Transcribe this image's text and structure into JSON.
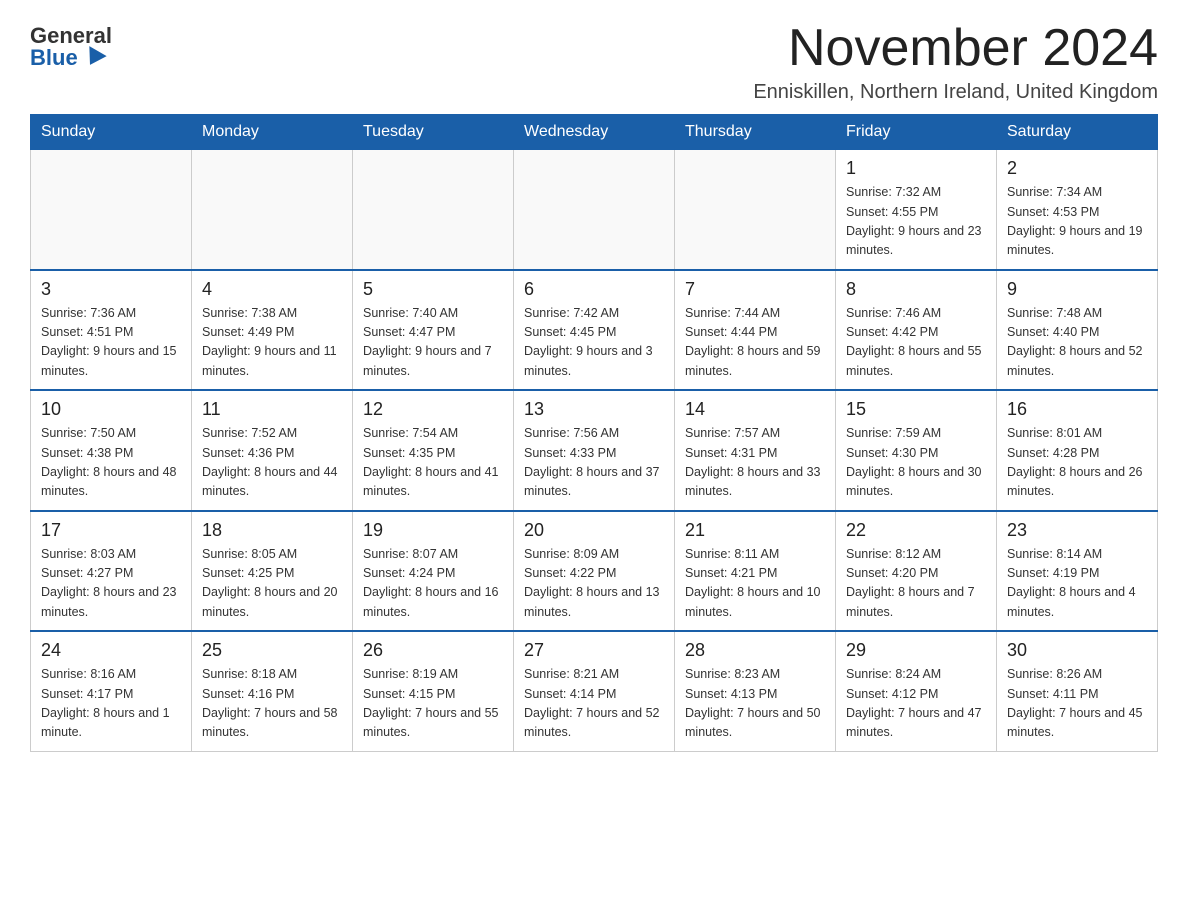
{
  "header": {
    "logo_general": "General",
    "logo_blue": "Blue",
    "month_title": "November 2024",
    "location": "Enniskillen, Northern Ireland, United Kingdom"
  },
  "calendar": {
    "weekdays": [
      "Sunday",
      "Monday",
      "Tuesday",
      "Wednesday",
      "Thursday",
      "Friday",
      "Saturday"
    ],
    "weeks": [
      [
        {
          "day": "",
          "sunrise": "",
          "sunset": "",
          "daylight": ""
        },
        {
          "day": "",
          "sunrise": "",
          "sunset": "",
          "daylight": ""
        },
        {
          "day": "",
          "sunrise": "",
          "sunset": "",
          "daylight": ""
        },
        {
          "day": "",
          "sunrise": "",
          "sunset": "",
          "daylight": ""
        },
        {
          "day": "",
          "sunrise": "",
          "sunset": "",
          "daylight": ""
        },
        {
          "day": "1",
          "sunrise": "Sunrise: 7:32 AM",
          "sunset": "Sunset: 4:55 PM",
          "daylight": "Daylight: 9 hours and 23 minutes."
        },
        {
          "day": "2",
          "sunrise": "Sunrise: 7:34 AM",
          "sunset": "Sunset: 4:53 PM",
          "daylight": "Daylight: 9 hours and 19 minutes."
        }
      ],
      [
        {
          "day": "3",
          "sunrise": "Sunrise: 7:36 AM",
          "sunset": "Sunset: 4:51 PM",
          "daylight": "Daylight: 9 hours and 15 minutes."
        },
        {
          "day": "4",
          "sunrise": "Sunrise: 7:38 AM",
          "sunset": "Sunset: 4:49 PM",
          "daylight": "Daylight: 9 hours and 11 minutes."
        },
        {
          "day": "5",
          "sunrise": "Sunrise: 7:40 AM",
          "sunset": "Sunset: 4:47 PM",
          "daylight": "Daylight: 9 hours and 7 minutes."
        },
        {
          "day": "6",
          "sunrise": "Sunrise: 7:42 AM",
          "sunset": "Sunset: 4:45 PM",
          "daylight": "Daylight: 9 hours and 3 minutes."
        },
        {
          "day": "7",
          "sunrise": "Sunrise: 7:44 AM",
          "sunset": "Sunset: 4:44 PM",
          "daylight": "Daylight: 8 hours and 59 minutes."
        },
        {
          "day": "8",
          "sunrise": "Sunrise: 7:46 AM",
          "sunset": "Sunset: 4:42 PM",
          "daylight": "Daylight: 8 hours and 55 minutes."
        },
        {
          "day": "9",
          "sunrise": "Sunrise: 7:48 AM",
          "sunset": "Sunset: 4:40 PM",
          "daylight": "Daylight: 8 hours and 52 minutes."
        }
      ],
      [
        {
          "day": "10",
          "sunrise": "Sunrise: 7:50 AM",
          "sunset": "Sunset: 4:38 PM",
          "daylight": "Daylight: 8 hours and 48 minutes."
        },
        {
          "day": "11",
          "sunrise": "Sunrise: 7:52 AM",
          "sunset": "Sunset: 4:36 PM",
          "daylight": "Daylight: 8 hours and 44 minutes."
        },
        {
          "day": "12",
          "sunrise": "Sunrise: 7:54 AM",
          "sunset": "Sunset: 4:35 PM",
          "daylight": "Daylight: 8 hours and 41 minutes."
        },
        {
          "day": "13",
          "sunrise": "Sunrise: 7:56 AM",
          "sunset": "Sunset: 4:33 PM",
          "daylight": "Daylight: 8 hours and 37 minutes."
        },
        {
          "day": "14",
          "sunrise": "Sunrise: 7:57 AM",
          "sunset": "Sunset: 4:31 PM",
          "daylight": "Daylight: 8 hours and 33 minutes."
        },
        {
          "day": "15",
          "sunrise": "Sunrise: 7:59 AM",
          "sunset": "Sunset: 4:30 PM",
          "daylight": "Daylight: 8 hours and 30 minutes."
        },
        {
          "day": "16",
          "sunrise": "Sunrise: 8:01 AM",
          "sunset": "Sunset: 4:28 PM",
          "daylight": "Daylight: 8 hours and 26 minutes."
        }
      ],
      [
        {
          "day": "17",
          "sunrise": "Sunrise: 8:03 AM",
          "sunset": "Sunset: 4:27 PM",
          "daylight": "Daylight: 8 hours and 23 minutes."
        },
        {
          "day": "18",
          "sunrise": "Sunrise: 8:05 AM",
          "sunset": "Sunset: 4:25 PM",
          "daylight": "Daylight: 8 hours and 20 minutes."
        },
        {
          "day": "19",
          "sunrise": "Sunrise: 8:07 AM",
          "sunset": "Sunset: 4:24 PM",
          "daylight": "Daylight: 8 hours and 16 minutes."
        },
        {
          "day": "20",
          "sunrise": "Sunrise: 8:09 AM",
          "sunset": "Sunset: 4:22 PM",
          "daylight": "Daylight: 8 hours and 13 minutes."
        },
        {
          "day": "21",
          "sunrise": "Sunrise: 8:11 AM",
          "sunset": "Sunset: 4:21 PM",
          "daylight": "Daylight: 8 hours and 10 minutes."
        },
        {
          "day": "22",
          "sunrise": "Sunrise: 8:12 AM",
          "sunset": "Sunset: 4:20 PM",
          "daylight": "Daylight: 8 hours and 7 minutes."
        },
        {
          "day": "23",
          "sunrise": "Sunrise: 8:14 AM",
          "sunset": "Sunset: 4:19 PM",
          "daylight": "Daylight: 8 hours and 4 minutes."
        }
      ],
      [
        {
          "day": "24",
          "sunrise": "Sunrise: 8:16 AM",
          "sunset": "Sunset: 4:17 PM",
          "daylight": "Daylight: 8 hours and 1 minute."
        },
        {
          "day": "25",
          "sunrise": "Sunrise: 8:18 AM",
          "sunset": "Sunset: 4:16 PM",
          "daylight": "Daylight: 7 hours and 58 minutes."
        },
        {
          "day": "26",
          "sunrise": "Sunrise: 8:19 AM",
          "sunset": "Sunset: 4:15 PM",
          "daylight": "Daylight: 7 hours and 55 minutes."
        },
        {
          "day": "27",
          "sunrise": "Sunrise: 8:21 AM",
          "sunset": "Sunset: 4:14 PM",
          "daylight": "Daylight: 7 hours and 52 minutes."
        },
        {
          "day": "28",
          "sunrise": "Sunrise: 8:23 AM",
          "sunset": "Sunset: 4:13 PM",
          "daylight": "Daylight: 7 hours and 50 minutes."
        },
        {
          "day": "29",
          "sunrise": "Sunrise: 8:24 AM",
          "sunset": "Sunset: 4:12 PM",
          "daylight": "Daylight: 7 hours and 47 minutes."
        },
        {
          "day": "30",
          "sunrise": "Sunrise: 8:26 AM",
          "sunset": "Sunset: 4:11 PM",
          "daylight": "Daylight: 7 hours and 45 minutes."
        }
      ]
    ]
  }
}
